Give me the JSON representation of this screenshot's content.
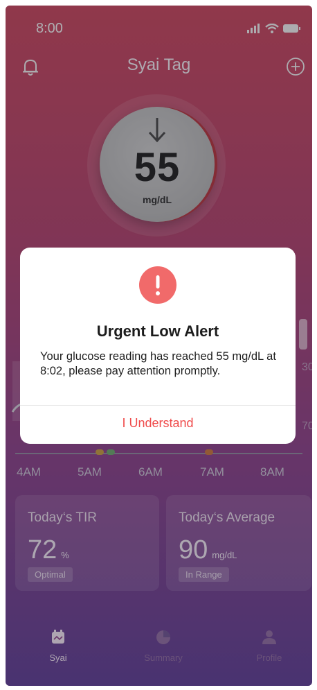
{
  "status": {
    "time": "8:00"
  },
  "header": {
    "title": "Syai Tag"
  },
  "glucose": {
    "value": "55",
    "unit": "mg/dL",
    "trend_icon": "arrow-down-icon"
  },
  "chart": {
    "y_labels": [
      "30",
      "70"
    ],
    "x_labels": [
      "4AM",
      "5AM",
      "6AM",
      "7AM",
      "8AM"
    ]
  },
  "cards": {
    "tir": {
      "title": "Today‘s TIR",
      "value": "72",
      "unit": "%",
      "badge": "Optimal"
    },
    "average": {
      "title": "Today‘s Average",
      "value": "90",
      "unit": "mg/dL",
      "badge": "In Range"
    }
  },
  "tabs": [
    {
      "label": "Syai",
      "icon": "home-icon"
    },
    {
      "label": "Summary",
      "icon": "pie-chart-icon"
    },
    {
      "label": "Profile",
      "icon": "person-icon"
    }
  ],
  "alert": {
    "icon": "exclamation-icon",
    "title": "Urgent Low Alert",
    "message": "Your glucose reading has reached 55 mg/dL at 8:02, please pay attention promptly.",
    "button": "I Understand"
  },
  "colors": {
    "accent": "#f16a6a",
    "button_text": "#ef4a4a"
  }
}
